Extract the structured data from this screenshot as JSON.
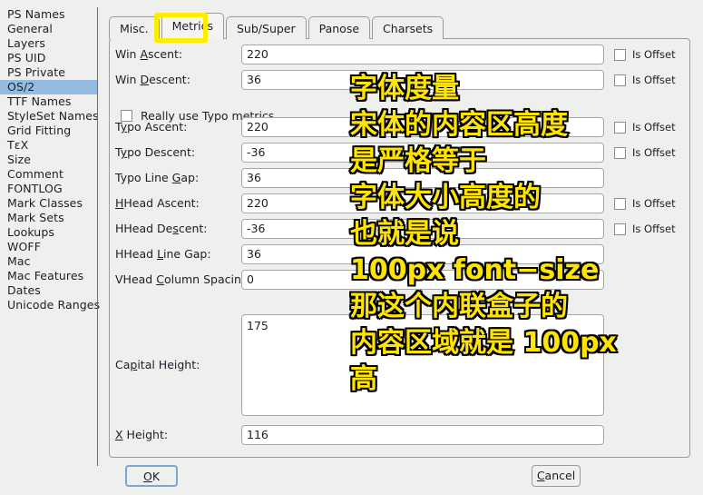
{
  "sidebar": {
    "items": [
      {
        "label": "PS Names",
        "selected": false
      },
      {
        "label": "General",
        "selected": false
      },
      {
        "label": "Layers",
        "selected": false
      },
      {
        "label": "PS UID",
        "selected": false
      },
      {
        "label": "PS Private",
        "selected": false
      },
      {
        "label": "OS/2",
        "selected": true
      },
      {
        "label": "TTF Names",
        "selected": false
      },
      {
        "label": "StyleSet Names",
        "selected": false
      },
      {
        "label": "Grid Fitting",
        "selected": false
      },
      {
        "label": "TεX",
        "selected": false
      },
      {
        "label": "Size",
        "selected": false
      },
      {
        "label": "Comment",
        "selected": false
      },
      {
        "label": "FONTLOG",
        "selected": false
      },
      {
        "label": "Mark Classes",
        "selected": false
      },
      {
        "label": "Mark Sets",
        "selected": false
      },
      {
        "label": "Lookups",
        "selected": false
      },
      {
        "label": "WOFF",
        "selected": false
      },
      {
        "label": "Mac",
        "selected": false
      },
      {
        "label": "Mac Features",
        "selected": false
      },
      {
        "label": "Dates",
        "selected": false
      },
      {
        "label": "Unicode Ranges",
        "selected": false
      }
    ]
  },
  "tabs": [
    {
      "label": "Misc.",
      "active": false
    },
    {
      "label": "Metrics",
      "active": true
    },
    {
      "label": "Sub/Super",
      "active": false
    },
    {
      "label": "Panose",
      "active": false
    },
    {
      "label": "Charsets",
      "active": false
    }
  ],
  "highlight_color": "#ffed00",
  "form": {
    "typo_checkbox": {
      "label": "Really use Typo metrics",
      "checked": false
    },
    "offset_label": "Is Offset",
    "rows": [
      {
        "label_pre": "Win ",
        "label_mnemonic": "A",
        "label_post": "scent:",
        "value": "220",
        "has_offset": true,
        "offset_checked": false
      },
      {
        "label_pre": "Win ",
        "label_mnemonic": "D",
        "label_post": "escent:",
        "value": "36",
        "has_offset": true,
        "offset_checked": false
      },
      {
        "label_pre": "T",
        "label_mnemonic": "y",
        "label_post": "po Ascent:",
        "value": "220",
        "has_offset": true,
        "offset_checked": false
      },
      {
        "label_pre": "T",
        "label_mnemonic": "y",
        "label_post": "po Descent:",
        "value": "-36",
        "has_offset": true,
        "offset_checked": false
      },
      {
        "label_pre": "Typo Line ",
        "label_mnemonic": "G",
        "label_post": "ap:",
        "value": "36",
        "has_offset": false,
        "offset_checked": false
      },
      {
        "label_pre": "",
        "label_mnemonic": "H",
        "label_post": "Head Ascent:",
        "value": "220",
        "has_offset": true,
        "offset_checked": false
      },
      {
        "label_pre": "HHead De",
        "label_mnemonic": "s",
        "label_post": "cent:",
        "value": "-36",
        "has_offset": true,
        "offset_checked": false
      },
      {
        "label_pre": "HHead ",
        "label_mnemonic": "L",
        "label_post": "ine Gap:",
        "value": "36",
        "has_offset": false,
        "offset_checked": false
      },
      {
        "label_pre": "VHead ",
        "label_mnemonic": "C",
        "label_post": "olumn Spacing:",
        "value": "0",
        "has_offset": false,
        "offset_checked": false
      }
    ],
    "capital_height": {
      "label_pre": "Ca",
      "label_mnemonic": "p",
      "label_post": "ital Height:",
      "value": "175"
    },
    "x_height": {
      "label_pre": "",
      "label_mnemonic": "X",
      "label_post": " Height:",
      "value": "116"
    }
  },
  "buttons": {
    "ok": {
      "pre": "",
      "mnemonic": "O",
      "post": "K"
    },
    "cancel": {
      "pre": "",
      "mnemonic": "C",
      "post": "ancel"
    }
  },
  "annotation": {
    "color": "#ffe400",
    "lines": [
      "字体度量",
      "宋体的内容区高度",
      "是严格等于",
      "字体大小高度的",
      "也就是说",
      "100px font−size",
      "那这个内联盒子的",
      "内容区域就是 100px",
      "高"
    ]
  }
}
